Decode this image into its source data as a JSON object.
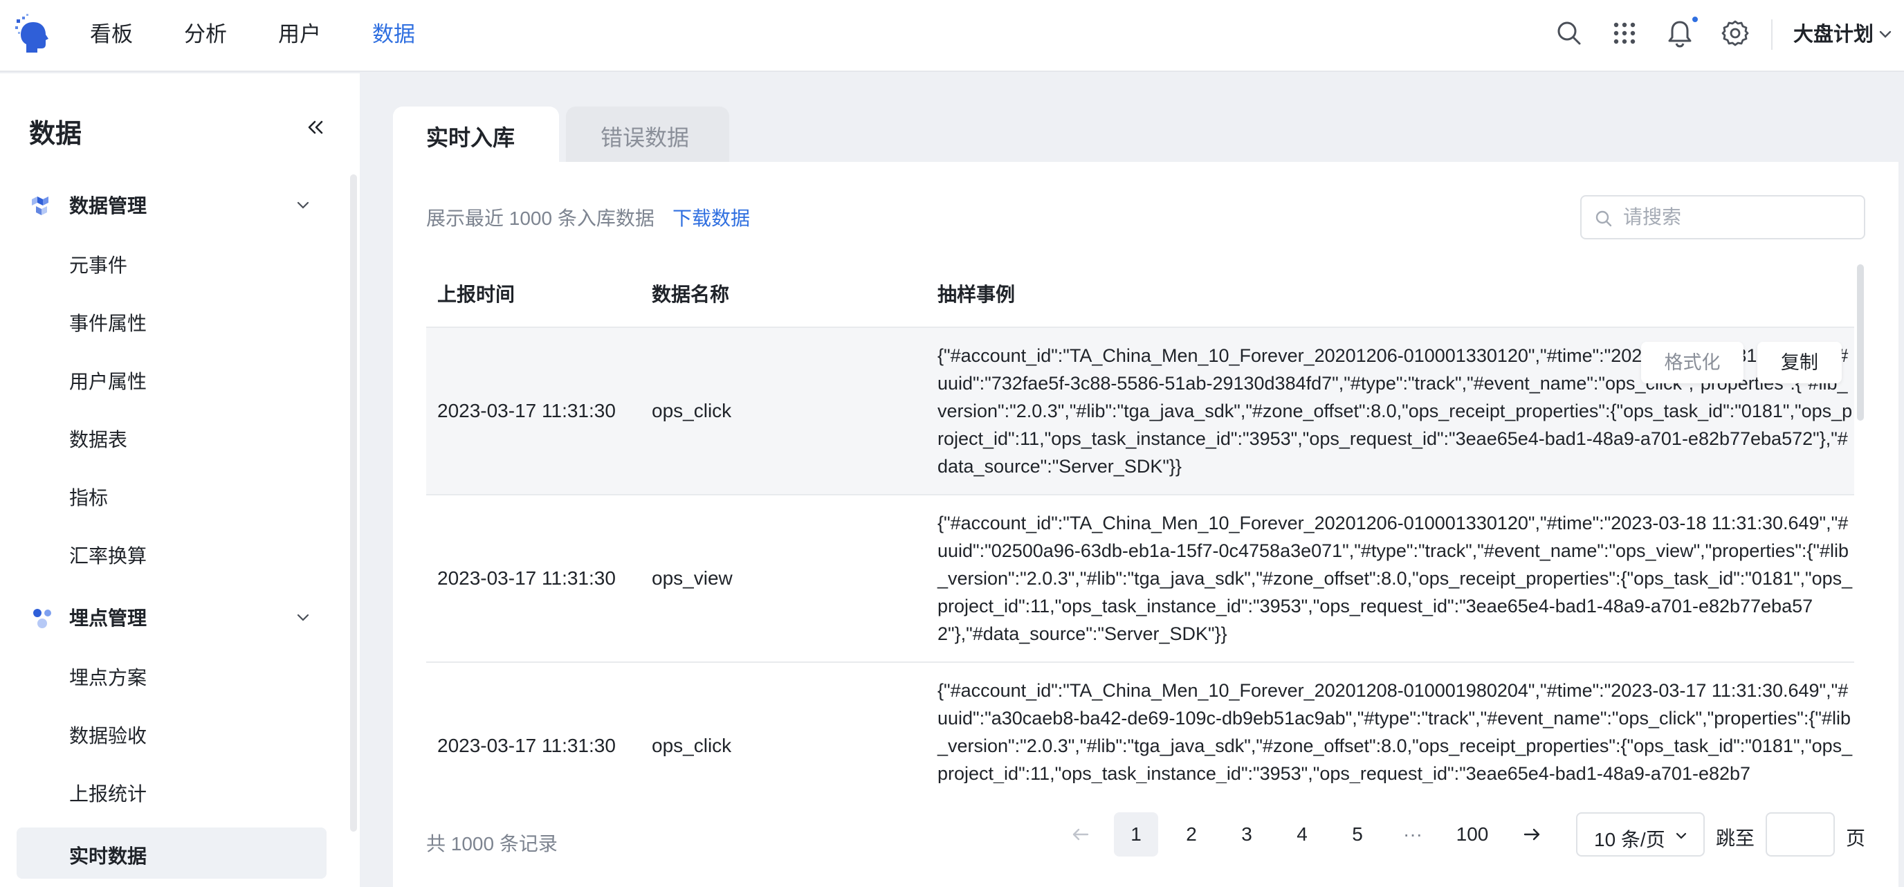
{
  "topnav": {
    "items": [
      {
        "label": "看板",
        "active": false
      },
      {
        "label": "分析",
        "active": false
      },
      {
        "label": "用户",
        "active": false
      },
      {
        "label": "数据",
        "active": true
      }
    ],
    "project": "大盘计划",
    "accent_color": "#2f6fe0"
  },
  "sidebar": {
    "title": "数据",
    "groups": [
      {
        "label": "数据管理",
        "icon": "cubes-icon",
        "items": [
          "元事件",
          "事件属性",
          "用户属性",
          "数据表",
          "指标",
          "汇率换算"
        ]
      },
      {
        "label": "埋点管理",
        "icon": "dots-icon",
        "items": [
          "埋点方案",
          "数据验收",
          "上报统计",
          "实时数据"
        ]
      }
    ],
    "active_item": "实时数据"
  },
  "tabs": [
    {
      "label": "实时入库",
      "active": true
    },
    {
      "label": "错误数据",
      "active": false
    }
  ],
  "toolbar": {
    "info": "展示最近 1000 条入库数据",
    "download": "下载数据",
    "search_placeholder": "请搜索"
  },
  "table": {
    "columns": [
      "上报时间",
      "数据名称",
      "抽样事例"
    ],
    "rows": [
      {
        "time": "2023-03-17 11:31:30",
        "name": "ops_click",
        "sample": "{\"#account_id\":\"TA_China_Men_10_Forever_20201206-010001330120\",\"#time\":\"2023-03-17 11:31:30.649\",\"#uuid\":\"732fae5f-3c88-5586-51ab-29130d384fd7\",\"#type\":\"track\",\"#event_name\":\"ops_click\",\"properties\":{\"#lib_version\":\"2.0.3\",\"#lib\":\"tga_java_sdk\",\"#zone_offset\":8.0,\"ops_receipt_properties\":{\"ops_task_id\":\"0181\",\"ops_project_id\":11,\"ops_task_instance_id\":\"3953\",\"ops_request_id\":\"3eae65e4-bad1-48a9-a701-e82b77eba572\"},\"#data_source\":\"Server_SDK\"}}"
      },
      {
        "time": "2023-03-17 11:31:30",
        "name": "ops_view",
        "sample": "{\"#account_id\":\"TA_China_Men_10_Forever_20201206-010001330120\",\"#time\":\"2023-03-18 11:31:30.649\",\"#uuid\":\"02500a96-63db-eb1a-15f7-0c4758a3e071\",\"#type\":\"track\",\"#event_name\":\"ops_view\",\"properties\":{\"#lib_version\":\"2.0.3\",\"#lib\":\"tga_java_sdk\",\"#zone_offset\":8.0,\"ops_receipt_properties\":{\"ops_task_id\":\"0181\",\"ops_project_id\":11,\"ops_task_instance_id\":\"3953\",\"ops_request_id\":\"3eae65e4-bad1-48a9-a701-e82b77eba572\"},\"#data_source\":\"Server_SDK\"}}"
      },
      {
        "time": "2023-03-17 11:31:30",
        "name": "ops_click",
        "sample": "{\"#account_id\":\"TA_China_Men_10_Forever_20201208-010001980204\",\"#time\":\"2023-03-17 11:31:30.649\",\"#uuid\":\"a30caeb8-ba42-de69-109c-db9eb51ac9ab\",\"#type\":\"track\",\"#event_name\":\"ops_click\",\"properties\":{\"#lib_version\":\"2.0.3\",\"#lib\":\"tga_java_sdk\",\"#zone_offset\":8.0,\"ops_receipt_properties\":{\"ops_task_id\":\"0181\",\"ops_project_id\":11,\"ops_task_instance_id\":\"3953\",\"ops_request_id\":\"3eae65e4-bad1-48a9-a701-e82b7"
      }
    ],
    "row_actions": {
      "format": "格式化",
      "copy": "复制"
    }
  },
  "pagination": {
    "total": "共 1000 条记录",
    "pages": [
      "1",
      "2",
      "3",
      "4",
      "5",
      "···",
      "100"
    ],
    "current": "1",
    "page_size": "10 条/页",
    "jump_label": "跳至",
    "page_label": "页"
  }
}
